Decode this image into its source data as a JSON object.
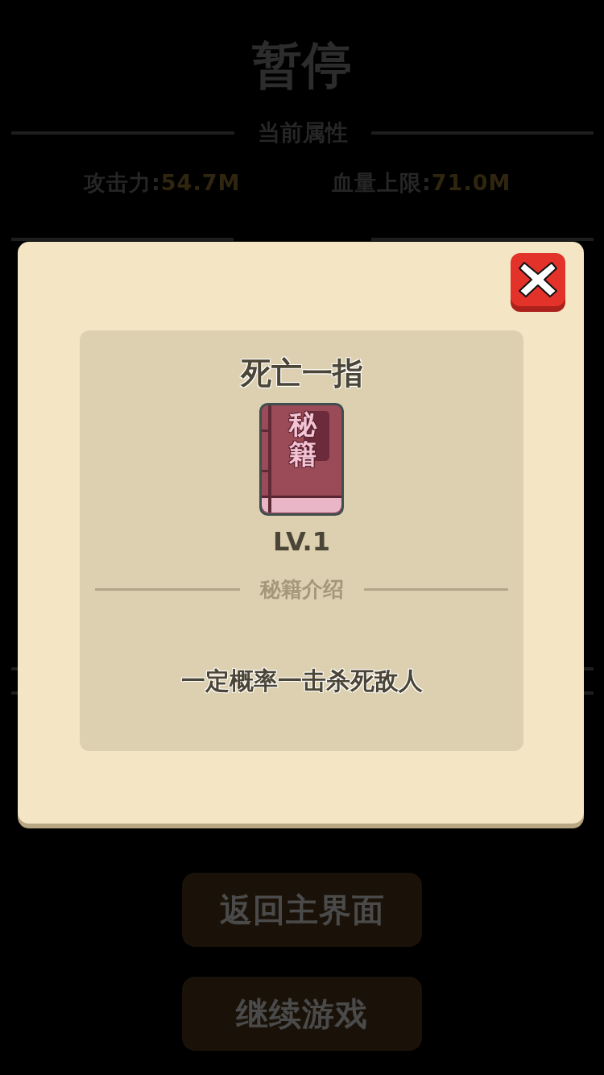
{
  "background": {
    "title": "暂停",
    "section": "当前属性",
    "stats": [
      {
        "label": "攻击力:",
        "value": "54.7M"
      },
      {
        "label": "血量上限:",
        "value": "71.0M"
      }
    ],
    "buttons": [
      "返回主界面",
      "继续游戏"
    ]
  },
  "dialog": {
    "title": "死亡一指",
    "book_cover_text": "秘籍",
    "rank": "LV.1",
    "section": "秘籍介绍",
    "description": "一定概率一击杀死敌人"
  }
}
